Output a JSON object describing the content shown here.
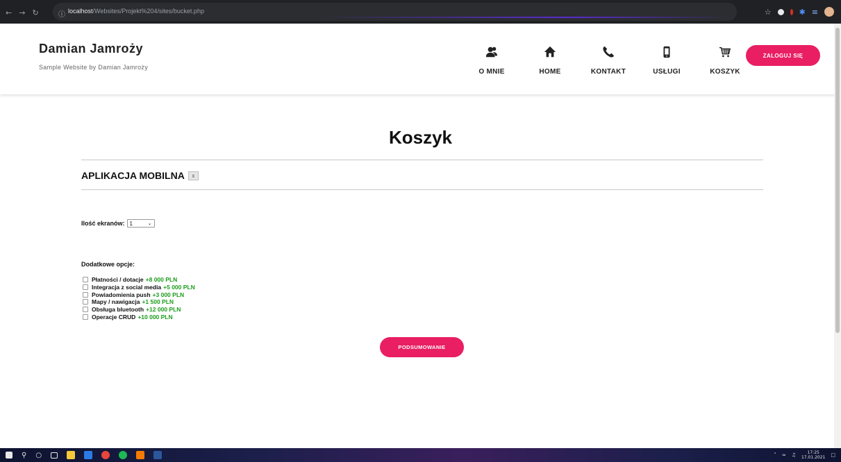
{
  "browser": {
    "url_host": "localhost",
    "url_path": "/Websites/Projekt%204/sites/bucket.php",
    "info_icon": "info-icon"
  },
  "site": {
    "title": "Damian Jamroży",
    "subtitle": "Sample Website by Damian Jamroży",
    "nav": [
      {
        "label": "O MNIE",
        "icon": "users-icon"
      },
      {
        "label": "HOME",
        "icon": "home-icon"
      },
      {
        "label": "KONTAKT",
        "icon": "phone-icon"
      },
      {
        "label": "USŁUGI",
        "icon": "mobile-icon"
      },
      {
        "label": "KOSZYK",
        "icon": "cart-icon"
      }
    ],
    "login_label": "ZALOGUJ SIĘ",
    "accent_color": "#e91e63"
  },
  "cart": {
    "title": "Koszyk",
    "product_title": "APLIKACJA MOBILNA",
    "remove_label": "x",
    "screens_label": "Ilość ekranów:",
    "screens_value": "1",
    "extras_label": "Dodatkowe opcje:",
    "options": [
      {
        "label": "Płatności / dotacje",
        "price": "+8 000 PLN",
        "checked": false
      },
      {
        "label": "Integracja z social media",
        "price": "+5 000 PLN",
        "checked": false
      },
      {
        "label": "Powiadomienia push",
        "price": "+3 000 PLN",
        "checked": false
      },
      {
        "label": "Mapy / nawigacja",
        "price": "+1 500 PLN",
        "checked": false
      },
      {
        "label": "Obsługa bluetooth",
        "price": "+12 000 PLN",
        "checked": false
      },
      {
        "label": "Operacje CRUD",
        "price": "+10 000 PLN",
        "checked": false
      }
    ],
    "price_color": "#1a9c1a",
    "summary_label": "PODSUMOWANIE"
  },
  "taskbar": {
    "time": "17:25",
    "date": "17.01.2021"
  }
}
